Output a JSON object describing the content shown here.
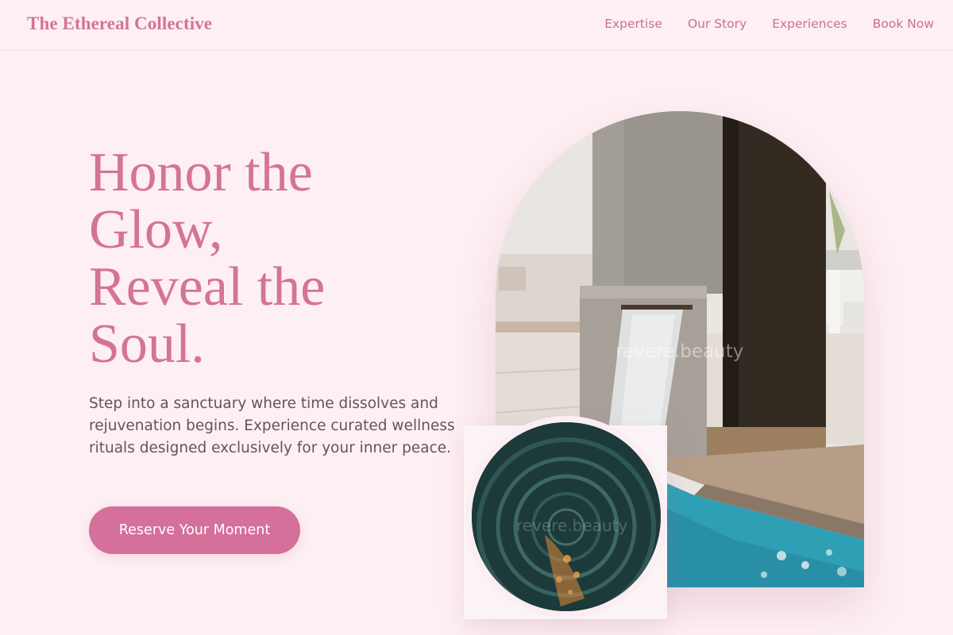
{
  "nav": {
    "brand": "The Ethereal Collective",
    "links": [
      "Expertise",
      "Our Story",
      "Experiences",
      "Book Now"
    ]
  },
  "hero": {
    "headline_lines": [
      "Honor the",
      "Glow,",
      "Reveal the",
      "Soul."
    ],
    "lede": "Step into a sanctuary where time dissolves and rejuvenation begins. Experience curated wellness rituals designed exclusively for your inner peace.",
    "cta_label": "Reserve Your Moment"
  },
  "images": {
    "arch_watermark": "revere.beauty",
    "circle_watermark": "revere.beauty"
  },
  "colors": {
    "background": "#fdeff3",
    "accent": "#d4709a",
    "body_text": "#5f5660"
  }
}
